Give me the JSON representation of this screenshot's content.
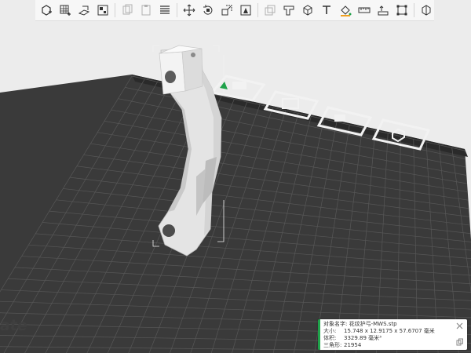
{
  "plate": {
    "brand_text": "ate"
  },
  "info_panel": {
    "name_label": "对象名字:",
    "name_value": "花纹护弓-MWS.stp",
    "size_label": "大小:",
    "size_value": "15.748 x 12.9175 x 57.6707 毫米",
    "volume_label": "体积:",
    "volume_value": "3329.89 毫米³",
    "triangles_label": "三角形:",
    "triangles_value": "21954"
  },
  "colors": {
    "accent": "#1fa24a",
    "plate": "#3a3a3a",
    "grid": "#585858",
    "model": "#e6e6e6"
  },
  "toolbar": {
    "icons": [
      "add-object-icon",
      "add-plate-icon",
      "auto-orient-icon",
      "arrange-icon",
      "copy-icon",
      "paste-icon",
      "layers-icon",
      "move-icon",
      "rotate-icon",
      "scale-icon",
      "lay-on-face-icon",
      "cut-icon",
      "support-paint-icon",
      "seam-paint-icon",
      "text-icon",
      "measure-icon",
      "assembly-icon",
      "fit-view-icon",
      "split-icon"
    ]
  }
}
